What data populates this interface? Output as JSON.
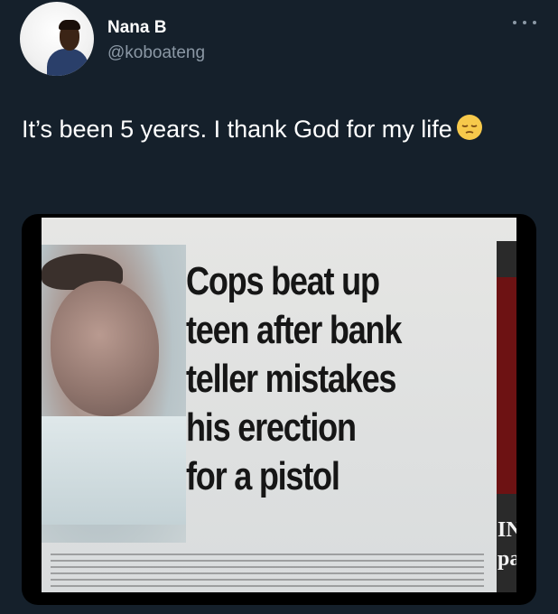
{
  "author": {
    "display_name": "Nana B",
    "handle": "@koboateng"
  },
  "icons": {
    "more": "more-horizontal-icon",
    "emoji": "pensive-face-emoji"
  },
  "tweet": {
    "text": "It’s been 5 years. I thank God for my life"
  },
  "media": {
    "headline_lines": [
      "Cops beat up",
      "teen after bank",
      "teller mistakes",
      "his erection",
      "for a pistol"
    ],
    "side_text": "IN pa"
  },
  "colors": {
    "background": "#15202b",
    "text": "#ffffff",
    "secondary_text": "#8b98a5"
  }
}
